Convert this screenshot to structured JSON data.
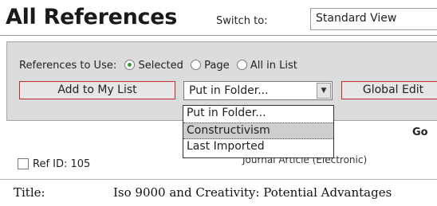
{
  "header": {
    "title": "All References",
    "switch_label": "Switch to:",
    "view_value": "Standard View"
  },
  "toolbar": {
    "refs_label": "References to Use:",
    "radio_selected": "Selected",
    "radio_page": "Page",
    "radio_all": "All in List",
    "add_button": "Add to My List",
    "folder_select_value": "Put in Folder...",
    "global_button": "Global Edit",
    "go_label": "Go"
  },
  "folder_dropdown": {
    "options": [
      "Put in Folder...",
      "Constructivism",
      "Last Imported"
    ],
    "highlighted": "Constructivism"
  },
  "reference": {
    "id_label": "Ref ID: 105",
    "type": "Journal Article (Electronic)",
    "title_field": "Title:",
    "title_value": "Iso 9000 and Creativity: Potential Advantages"
  },
  "colors": {
    "panel_bg": "#dcdcdc",
    "button_border": "#c32a2a",
    "radio_dot": "#3a9a3a"
  }
}
